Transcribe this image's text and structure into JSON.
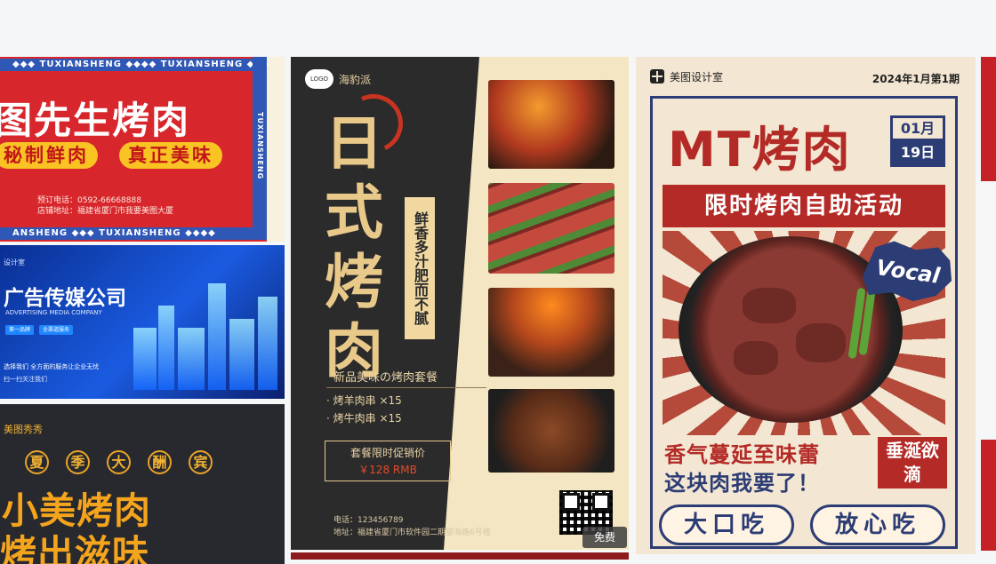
{
  "gallery": {
    "card1": {
      "strip_top": "◆◆◆ TUXIANSHENG ◆◆◆◆ TUXIANSHENG ◆◆◆",
      "strip_bottom": "ANSHENG ◆◆◆ TUXIANSHENG ◆◆◆◆",
      "vertical": "TUXIANSHENG",
      "title": "图先生烤肉",
      "pill1": "秘制鲜肉",
      "pill2": "真正美味",
      "phone": "预订电话：0592-66668888",
      "address": "店铺地址：福建省厦门市我要美图大厦"
    },
    "card2": {
      "brand": "设计室",
      "title": "广告传媒公司",
      "subtitle": "ADVERTISING MEDIA COMPANY",
      "btn1": "第一品牌",
      "btn2": "全渠道服务",
      "slogan": "选择我们 全方面的服务让企业无忧",
      "slogan2": "扫一扫关注我们"
    },
    "card3": {
      "brand": "美图秀秀",
      "circles": [
        "夏",
        "季",
        "大",
        "酬",
        "宾"
      ],
      "line1": "小美烤肉",
      "line2": "烤出滋味"
    },
    "card4": {
      "logo": "LOGO",
      "brand": "海豹派",
      "title": "日式烤肉",
      "tag": "鲜香多汁肥而不腻",
      "subtitle": "新品美味の烤肉套餐",
      "items": [
        "· 烤羊肉串 ×15",
        "· 烤牛肉串 ×15"
      ],
      "promo_label": "套餐限时促销价",
      "promo_price": "￥128 RMB",
      "phone": "电话：123456789",
      "address": "地址：福建省厦门市软件园二期望海路6号楼",
      "free_badge": "免费"
    },
    "card5": {
      "brand": "美图设计室",
      "date": "2024年1月第1期",
      "title": "MT烤肉",
      "month": "01月",
      "day": "19日",
      "banner": "限时烤肉自助活动",
      "sticker": "Vocal",
      "slogan1": "香气蔓延至味蕾",
      "slogan2": "这块肉我要了！",
      "stamp": "垂涎欲滴",
      "btn1": "大口吃",
      "btn2": "放心吃"
    }
  }
}
